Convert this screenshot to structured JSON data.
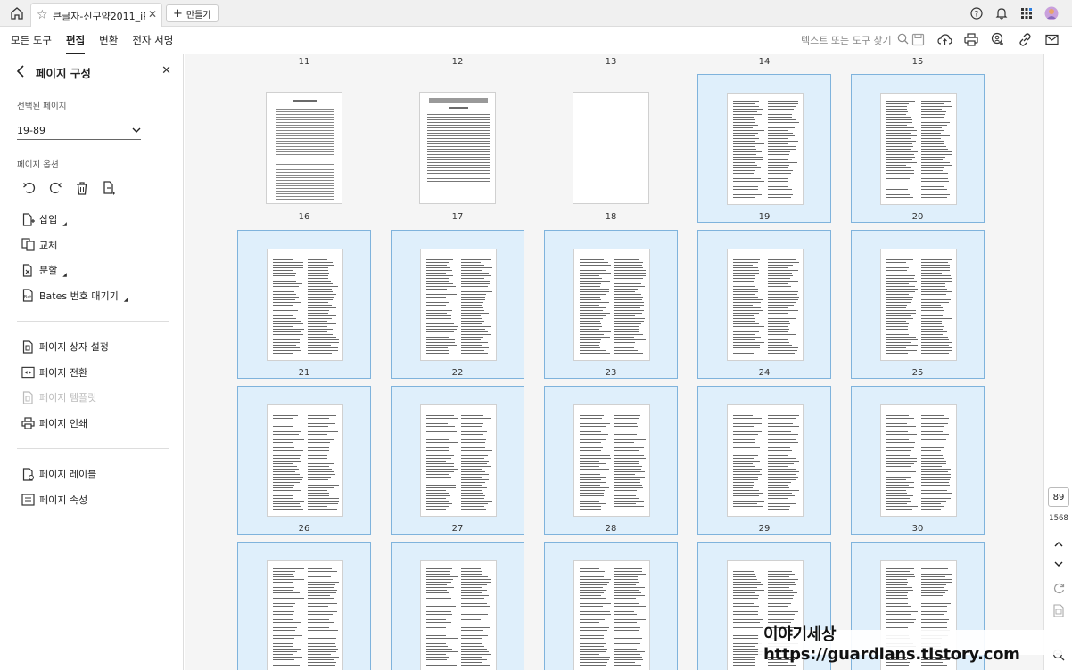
{
  "tab": {
    "title": "큰글자-신구약2011_iPa...",
    "new_tab_label": "만들기"
  },
  "menu": {
    "items": [
      "모든 도구",
      "편집",
      "변환",
      "전자 서명"
    ],
    "active_index": 1,
    "search_placeholder": "텍스트 또는 도구 찾기"
  },
  "panel": {
    "title": "페이지 구성",
    "selected_pages_label": "선택된 페이지",
    "selected_pages_value": "19-89",
    "page_options_label": "페이지 옵션",
    "options": [
      {
        "label": "삽입",
        "icon": "insert-page-icon",
        "submenu": true,
        "disabled": false
      },
      {
        "label": "교체",
        "icon": "replace-page-icon",
        "submenu": false,
        "disabled": false
      },
      {
        "label": "분할",
        "icon": "split-page-icon",
        "submenu": true,
        "disabled": false
      },
      {
        "label": "Bates 번호 매기기",
        "icon": "bates-icon",
        "submenu": true,
        "disabled": false
      }
    ],
    "options2": [
      {
        "label": "페이지 상자 설정",
        "icon": "page-box-icon",
        "disabled": false
      },
      {
        "label": "페이지 전환",
        "icon": "page-transition-icon",
        "disabled": false
      },
      {
        "label": "페이지 템플릿",
        "icon": "page-template-icon",
        "disabled": true
      },
      {
        "label": "페이지 인쇄",
        "icon": "print-icon",
        "disabled": false
      }
    ],
    "options3": [
      {
        "label": "페이지 레이블",
        "icon": "page-label-icon",
        "disabled": false
      },
      {
        "label": "페이지 속성",
        "icon": "page-properties-icon",
        "disabled": false
      }
    ]
  },
  "grid": {
    "top_labels": [
      "11",
      "12",
      "13",
      "14",
      "15"
    ],
    "rows": [
      [
        {
          "num": "16",
          "selected": false,
          "kind": "table"
        },
        {
          "num": "17",
          "selected": false,
          "kind": "doc"
        },
        {
          "num": "18",
          "selected": false,
          "kind": "blank"
        },
        {
          "num": "19",
          "selected": true,
          "kind": "text"
        },
        {
          "num": "20",
          "selected": true,
          "kind": "text"
        }
      ],
      [
        {
          "num": "21",
          "selected": true,
          "kind": "text"
        },
        {
          "num": "22",
          "selected": true,
          "kind": "text"
        },
        {
          "num": "23",
          "selected": true,
          "kind": "text"
        },
        {
          "num": "24",
          "selected": true,
          "kind": "text"
        },
        {
          "num": "25",
          "selected": true,
          "kind": "text"
        }
      ],
      [
        {
          "num": "26",
          "selected": true,
          "kind": "text"
        },
        {
          "num": "27",
          "selected": true,
          "kind": "text"
        },
        {
          "num": "28",
          "selected": true,
          "kind": "text"
        },
        {
          "num": "29",
          "selected": true,
          "kind": "text"
        },
        {
          "num": "30",
          "selected": true,
          "kind": "text"
        }
      ],
      [
        {
          "num": "",
          "selected": true,
          "kind": "text"
        },
        {
          "num": "",
          "selected": true,
          "kind": "text"
        },
        {
          "num": "",
          "selected": true,
          "kind": "text"
        },
        {
          "num": "",
          "selected": true,
          "kind": "text"
        },
        {
          "num": "",
          "selected": true,
          "kind": "text"
        }
      ]
    ]
  },
  "rail": {
    "current_page": "89",
    "total_pages": "1568"
  },
  "watermark": "이야기세상 https://guardians.tistory.com"
}
